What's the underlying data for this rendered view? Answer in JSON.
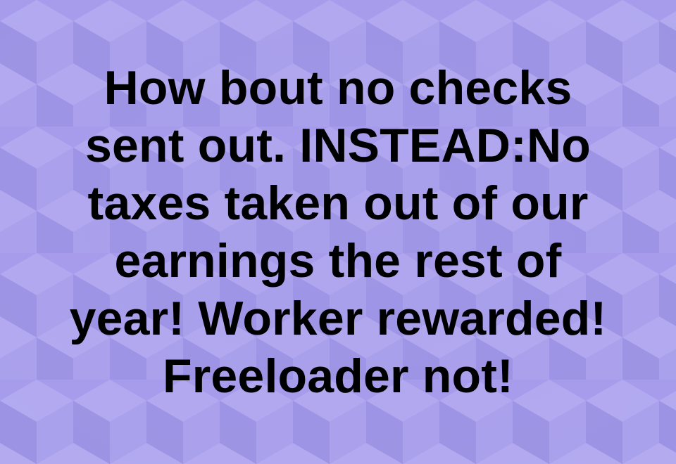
{
  "post": {
    "lines": [
      "How bout no checks",
      "sent out. INSTEAD:No",
      "taxes taken out of our",
      "earnings the rest of",
      "year! Worker rewarded!",
      "Freeloader not!"
    ]
  },
  "colors": {
    "background": "#a69ceb",
    "cube_top": "#b3aaf0",
    "cube_left": "#9d93e4",
    "cube_right": "#aaa1ec",
    "text": "#000000"
  }
}
